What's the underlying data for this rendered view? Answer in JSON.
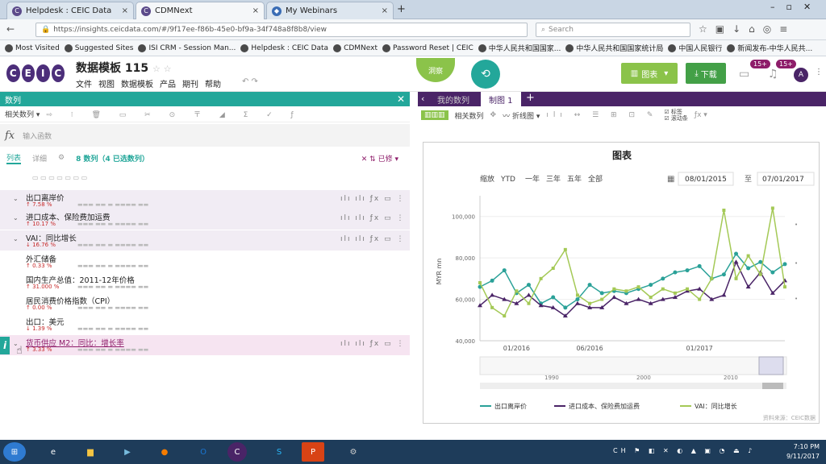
{
  "browser": {
    "tabs": [
      {
        "label": "Helpdesk : CEIC Data"
      },
      {
        "label": "CDMNext"
      },
      {
        "label": "My Webinars"
      }
    ],
    "url": "https://insights.ceicdata.com/#/9f17ee-f86b-45e0-bf9a-34f748a8f8b8/view",
    "search_placeholder": "Search",
    "bookmarks": [
      "Most Visited",
      "Suggested Sites",
      "ISI CRM - Session Man...",
      "Helpdesk : CEIC Data",
      "CDMNext",
      "Password Reset | CEIC",
      "中华人民共和国国家...",
      "中华人民共和国国家统计局",
      "中国人民银行",
      "新闻发布-中华人民共..."
    ]
  },
  "app": {
    "logo": [
      "C",
      "E",
      "I",
      "C"
    ],
    "title": "数据模板 115",
    "menu": [
      "文件",
      "视图",
      "数据模板",
      "产品",
      "期刊",
      "帮助"
    ],
    "insight_btn": "洞察",
    "view_btn": "图表",
    "download_btn": "下载",
    "badge1": "15+",
    "badge2": "15+",
    "avatar": "A"
  },
  "left": {
    "header": "数列",
    "formula_placeholder": "输入函数",
    "tabs": [
      "列表",
      "详细"
    ],
    "count": "8 数列（4 已选数列）",
    "filter": "已修",
    "rows": [
      {
        "name": "出口离岸价",
        "change": "↑ 7.58 %"
      },
      {
        "name": "进口成本、保险费加运费",
        "change": "↑ 10.17 %"
      },
      {
        "name": "VAI：同比增长",
        "change": "↓ 16.76 %"
      },
      {
        "name": "外汇储备",
        "change": "↑ 0.33 %"
      },
      {
        "name": "国内生产总值：2011-12年价格",
        "change": "↑ 31.000 %"
      },
      {
        "name": "居民消费价格指数（CPI）",
        "change": "↑ 0.00 %"
      },
      {
        "name": "出口：美元",
        "change": "↓ 1.39 %"
      },
      {
        "name": "货币供应 M2：同比：增长率",
        "change": "↑ 3.33 %"
      }
    ]
  },
  "right": {
    "tabs": [
      "我的数列",
      "制图 1"
    ],
    "tools": [
      "相关数列",
      "折线图"
    ],
    "checks": [
      "标签",
      "滚动条"
    ]
  },
  "chart_data": {
    "type": "line",
    "title": "图表",
    "range_buttons": [
      "缩放",
      "YTD",
      "一年",
      "三年",
      "五年",
      "全部"
    ],
    "from_date": "08/01/2015",
    "to_label": "至",
    "to_date": "07/01/2017",
    "ylabel": "MYR mn",
    "y_ticks": [
      "100,000",
      "80,000",
      "60,000",
      "40,000"
    ],
    "x_ticks": [
      "01/2016",
      "06/2016",
      "01/2017"
    ],
    "navigator_ticks": [
      "1990",
      "2000",
      "2010"
    ],
    "ylim": [
      40000,
      110000
    ],
    "series": [
      {
        "name": "出口离岸价",
        "color": "#2aa198",
        "values": [
          66000,
          69000,
          74000,
          63000,
          67000,
          58000,
          61000,
          56000,
          60000,
          67000,
          63000,
          64000,
          63000,
          65000,
          67000,
          70000,
          73000,
          74000,
          76000,
          70000,
          72000,
          82000,
          75000,
          78000,
          73000,
          77000
        ]
      },
      {
        "name": "进口成本、保险费加运费",
        "color": "#4a2467",
        "values": [
          57000,
          62000,
          60000,
          58000,
          62000,
          57000,
          56000,
          52000,
          58000,
          56000,
          56000,
          61000,
          58000,
          60000,
          58000,
          60000,
          61000,
          64000,
          65000,
          60000,
          62000,
          78000,
          66000,
          73000,
          63000,
          69000
        ]
      },
      {
        "name": "VAI：同比增长",
        "color": "#a4c956",
        "values": [
          68000,
          56000,
          52000,
          64000,
          58000,
          70000,
          75000,
          84000,
          62000,
          58000,
          60000,
          65000,
          64000,
          66000,
          61000,
          65000,
          63000,
          65000,
          60000,
          70000,
          103000,
          70000,
          81000,
          72000,
          104000,
          66000
        ]
      }
    ],
    "source": "资料来源：CEIC数据"
  },
  "taskbar": {
    "time": "7:10 PM",
    "date": "9/11/2017"
  }
}
